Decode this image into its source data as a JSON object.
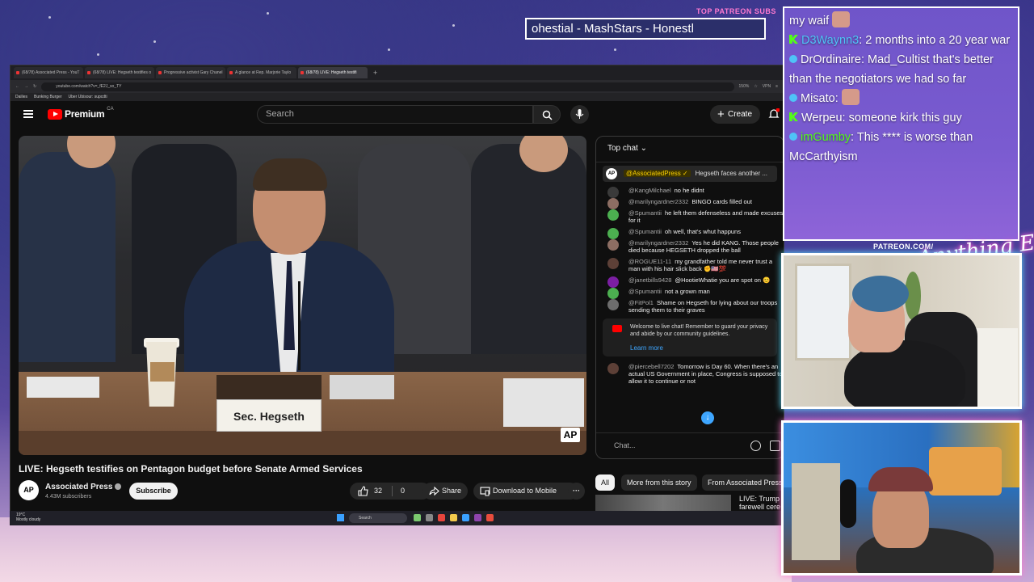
{
  "overlay": {
    "patreon_label": "TOP PATREON SUBS",
    "ticker_text": "ohestial - MashStars - Honestl",
    "patreon_url": "PATREON.COM/",
    "brand_logo": "Anything Else?"
  },
  "browser": {
    "tabs": [
      {
        "label": "(68/78) Associated Press - YouT"
      },
      {
        "label": "(68/78) LIVE: Hegseth testifies o"
      },
      {
        "label": "Progressive activist Gary Chanel"
      },
      {
        "label": "A glance at Rep. Marjorie Taylo"
      },
      {
        "label": "(68/78) LIVE: Hegseth testifi"
      }
    ],
    "url": "youtube.com/watch?v=_fE2J_so_TY",
    "zoom": "150%",
    "vpn": "VPN",
    "bookmarks": [
      "Dailies",
      "Bunking Burger",
      "Uber Ubisour: supcdti"
    ]
  },
  "youtube": {
    "logo_text": "Premium",
    "region": "CA",
    "search_placeholder": "Search",
    "create_label": "Create",
    "video_nameplate": "Sec. Hegseth",
    "video_watermark": "AP",
    "video_title": "LIVE: Hegseth testifies on Pentagon budget before Senate Armed Services",
    "channel": {
      "avatar": "AP",
      "name": "Associated Press",
      "subscribers": "4.43M subscribers",
      "subscribe_label": "Subscribe"
    },
    "actions": {
      "likes": "32",
      "dislikes": "0",
      "share": "Share",
      "download": "Download to Mobile",
      "more": "···"
    }
  },
  "chat": {
    "header": "Top chat",
    "pinned": {
      "avatar": "AP",
      "author": "@AssociatedPress ✓",
      "text": "Hegseth faces another ..."
    },
    "messages": [
      {
        "author": "@KangMilchael",
        "text": "no he didnt",
        "color": "#3a3a3a"
      },
      {
        "author": "@marilyngardner2332",
        "text": "BINGO cards filled out",
        "color": "#8d6e63"
      },
      {
        "author": "@Spumantii",
        "text": "he left them defenseless and made excuses for it",
        "color": "#4caf50"
      },
      {
        "author": "@Spumantii",
        "text": "oh well, that's whut happuns",
        "color": "#4caf50"
      },
      {
        "author": "@marilyngardner2332",
        "text": "Yes he did KANG. Those people died because HEGSETH dropped the ball",
        "color": "#8d6e63"
      },
      {
        "author": "@ROGUE11-11",
        "text": "my grandfather told me never trust a man with his hair slick back ✊🇺🇸💯",
        "color": "#5d4037"
      },
      {
        "author": "@janetbills9428",
        "text": "@HootieWhatie you are spot on 😊",
        "color": "#7b1fa2"
      },
      {
        "author": "@Spumantii",
        "text": "not a grown man",
        "color": "#4caf50"
      },
      {
        "author": "@FitPol1",
        "text": "Shame on Hegseth for lying about our troops sending them to their graves",
        "color": "#6d6d6d"
      }
    ],
    "welcome_text": "Welcome to live chat! Remember to guard your privacy and abide by our community guidelines.",
    "learn_more": "Learn more",
    "last_message": {
      "author": "@piercebell7202",
      "text": "Tomorrow is Day 60. When there's an actual US Government in place, Congress is supposed to allow it to continue or not",
      "color": "#5d4037"
    },
    "input_placeholder": "Chat..."
  },
  "chips": [
    "All",
    "More from this story",
    "From Associated Press"
  ],
  "recommendation": {
    "title": "LIVE: Trump farewell cere"
  },
  "taskbar": {
    "weather_temp": "19°C",
    "weather_desc": "Mostly cloudy",
    "search": "Search"
  },
  "twitch_chat": [
    {
      "user": "",
      "text": "my waif",
      "user_color": "#ffffff",
      "badge": "none",
      "emote": true
    },
    {
      "user": "D3Waynn3",
      "text": ": 2 months into a 20 year war",
      "user_color": "#4fc3f7",
      "badge": "kick"
    },
    {
      "user": "DrOrdinaire",
      "text": ": Mad_Cultist that's better than the negotiators we had so far",
      "user_color": "#ffffff",
      "badge": "dot"
    },
    {
      "user": "Misato",
      "text": ":",
      "user_color": "#ffffff",
      "badge": "dot",
      "emote": true
    },
    {
      "user": "Werpeu",
      "text": ": someone kirk this guy",
      "user_color": "#ffffff",
      "badge": "kick"
    },
    {
      "user": "imGumby",
      "text": ": This **** is worse than McCarthyism",
      "user_color": "#53fc18",
      "badge": "dot"
    }
  ],
  "colors": {
    "youtube_red": "#ff0000",
    "link_blue": "#3ea6ff",
    "kick_green": "#53fc18",
    "overlay_purple": "#7a5bd0",
    "neon_pink": "#ff5ad6"
  }
}
